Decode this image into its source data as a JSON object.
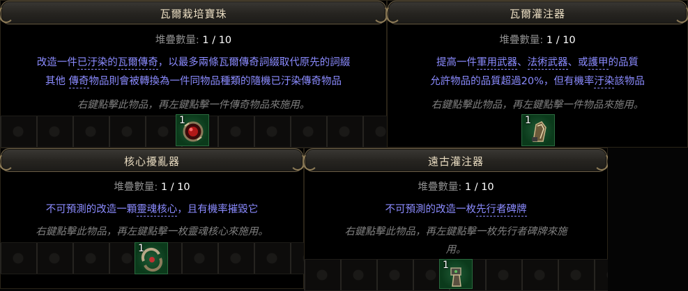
{
  "cards": [
    {
      "title": "瓦爾栽培寶珠",
      "stack_label": "堆疊數量:",
      "stack_value": "1 / 10",
      "mod_line1_a": "改造一件",
      "mod_line1_u1": "已汙染",
      "mod_line1_b": "的",
      "mod_line1_u2": "瓦爾傳奇",
      "mod_line1_c": "，以最多兩條瓦爾傳奇詞綴取代原先的詞綴",
      "mod_line2_a": "其他 ",
      "mod_line2_u": "傳奇",
      "mod_line2_b": "物品則會被轉換為一件同物品種類的隨機已汙染傳奇物品",
      "flavour": "右鍵點擊此物品，再左鍵點擊一件傳奇物品來施用。",
      "quantity": "1",
      "icon": "vaal-cultivation-orb-icon"
    },
    {
      "title": "瓦爾灌注器",
      "stack_label": "堆疊數量:",
      "stack_value": "1 / 10",
      "mod_line1_a": "提高一件",
      "mod_line1_u1": "軍用武器",
      "mod_line1_b": "、",
      "mod_line1_u2": "法術武器",
      "mod_line1_c": "、或",
      "mod_line1_u3": "護甲",
      "mod_line1_d": "的品質",
      "mod_line2_a": "允許物品的品質超過20%，但有機率",
      "mod_line2_u": "汙染",
      "mod_line2_b": "該物品",
      "flavour": "右鍵點擊此物品，再左鍵點擊一件物品來施用。",
      "quantity": "1",
      "icon": "vaal-infuser-icon"
    },
    {
      "title": "核心擾亂器",
      "stack_label": "堆疊數量:",
      "stack_value": "1 / 10",
      "mod_line1_a": "不可預測的改造一顆",
      "mod_line1_u1": "靈魂核心",
      "mod_line1_b": "，且有機率摧毀它",
      "flavour": "右鍵點擊此物品，再左鍵點擊一枚靈魂核心來施用。",
      "quantity": "1",
      "icon": "core-destabiliser-icon"
    },
    {
      "title": "遠古灌注器",
      "stack_label": "堆疊數量:",
      "stack_value": "1 / 10",
      "mod_line1_a": "不可預測的改造一枚",
      "mod_line1_u1": "先行者碑牌",
      "flavour_line1": "右鍵點擊此物品，再左鍵點擊一枚先行者碑牌來施",
      "flavour_line2": "用。",
      "quantity": "1",
      "icon": "ancient-infuser-icon"
    }
  ]
}
